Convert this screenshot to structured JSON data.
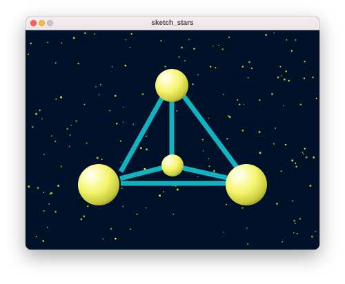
{
  "window": {
    "title": "sketch_stars"
  },
  "sketch": {
    "background_color": "#00112a",
    "star_color": "#d7f22a",
    "edge_color": "#11b3c0",
    "sphere_color": "#f4f46a",
    "sphere_count": 4,
    "edge_count": 6,
    "star_count": 180
  }
}
